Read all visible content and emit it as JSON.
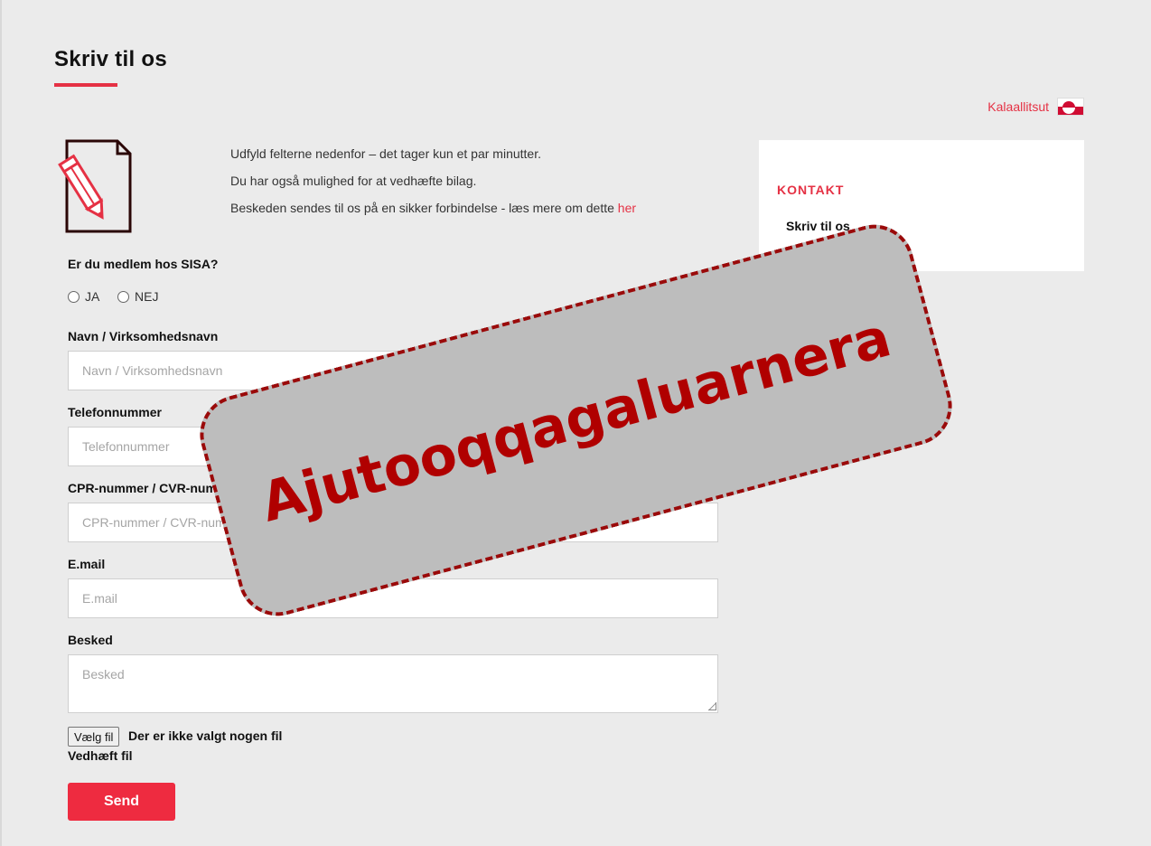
{
  "header": {
    "title": "Skriv til os",
    "language_label": "Kalaallitsut",
    "language_icon": "greenland-flag-icon"
  },
  "intro": {
    "line1": "Udfyld felterne nedenfor – det tager kun et par minutter.",
    "line2": "Du har også mulighed for at vedhæfte bilag.",
    "line3": "Beskeden sendes til os på en sikker forbindelse - læs mere om dette",
    "line3_link": "her",
    "icon": "document-pencil-icon"
  },
  "sidebar": {
    "heading": "KONTAKT",
    "link": "Skriv til os"
  },
  "form": {
    "membership_question": "Er du medlem hos SISA?",
    "option_yes": "JA",
    "option_no": "NEJ",
    "name_label": "Navn / Virksomhedsnavn",
    "name_placeholder": "Navn / Virksomhedsnavn",
    "phone_label": "Telefonnummer",
    "phone_placeholder": "Telefonnummer",
    "cpr_label": "CPR-nummer / CVR-nummer",
    "cpr_placeholder": "CPR-nummer / CVR-nummer",
    "email_label": "E.mail",
    "email_placeholder": "E.mail",
    "message_label": "Besked",
    "message_placeholder": "Besked",
    "file_button": "Vælg fil",
    "file_status": "Der er ikke valgt nogen fil",
    "attach_label": "Vedhæft fil",
    "submit": "Send"
  },
  "overlay": {
    "stamp_text": "Ajutooqqagaluarnera"
  },
  "colors": {
    "accent": "#e53144",
    "button": "#ee2b40",
    "stamp_text": "#b00000",
    "stamp_bg": "#bdbdbd"
  }
}
